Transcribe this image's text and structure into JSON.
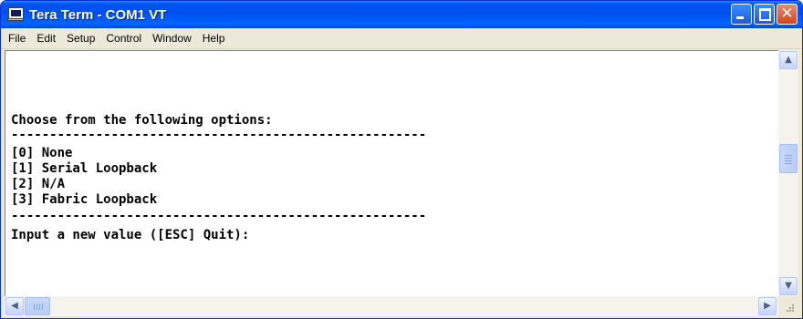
{
  "window": {
    "title": "Tera Term - COM1 VT",
    "icons": {
      "app": "terminal-app-icon",
      "minimize": "minimize-icon",
      "maximize": "maximize-icon",
      "close": "close-icon"
    },
    "close_glyph": "✕"
  },
  "menubar": {
    "items": [
      "File",
      "Edit",
      "Setup",
      "Control",
      "Window",
      "Help"
    ]
  },
  "terminal": {
    "lines": [
      "",
      "Choose from the following options:",
      "------------------------------------------------------",
      "[0] None",
      "[1] Serial Loopback",
      "[2] N/A",
      "[3] Fabric Loopback",
      "------------------------------------------------------",
      "Input a new value ([ESC] Quit):"
    ]
  },
  "scrollbars": {
    "up_arrow": "▲",
    "down_arrow": "▼",
    "left_arrow": "◀",
    "right_arrow": "▶"
  }
}
